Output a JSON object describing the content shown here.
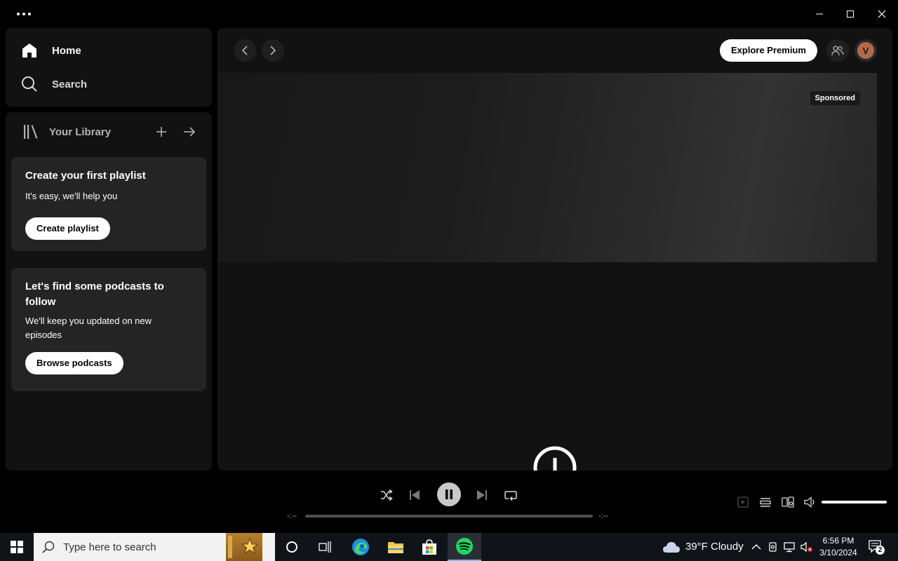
{
  "nav": {
    "home_label": "Home",
    "search_label": "Search"
  },
  "library": {
    "title": "Your Library",
    "playlist_card": {
      "title": "Create your first playlist",
      "text": "It's easy, we'll help you",
      "button": "Create playlist"
    },
    "podcast_card": {
      "title": "Let's find some podcasts to follow",
      "text": "We'll keep you updated on new episodes",
      "button": "Browse podcasts"
    }
  },
  "header": {
    "premium_label": "Explore Premium",
    "avatar_initial": "V"
  },
  "banner": {
    "sponsored_label": "Sponsored"
  },
  "player": {
    "elapsed": "-:--",
    "remaining": "-:--",
    "state": "playing",
    "progress": 0,
    "volume": 1.0
  },
  "taskbar": {
    "search_placeholder": "Type here to search",
    "weather": {
      "temp": "39°F",
      "condition": "Cloudy"
    },
    "clock": {
      "time": "6:56 PM",
      "date": "3/10/2024"
    },
    "notification_count": "2"
  },
  "colors": {
    "spotify_green": "#1ed760",
    "surface": "#121212",
    "card": "#242424"
  }
}
